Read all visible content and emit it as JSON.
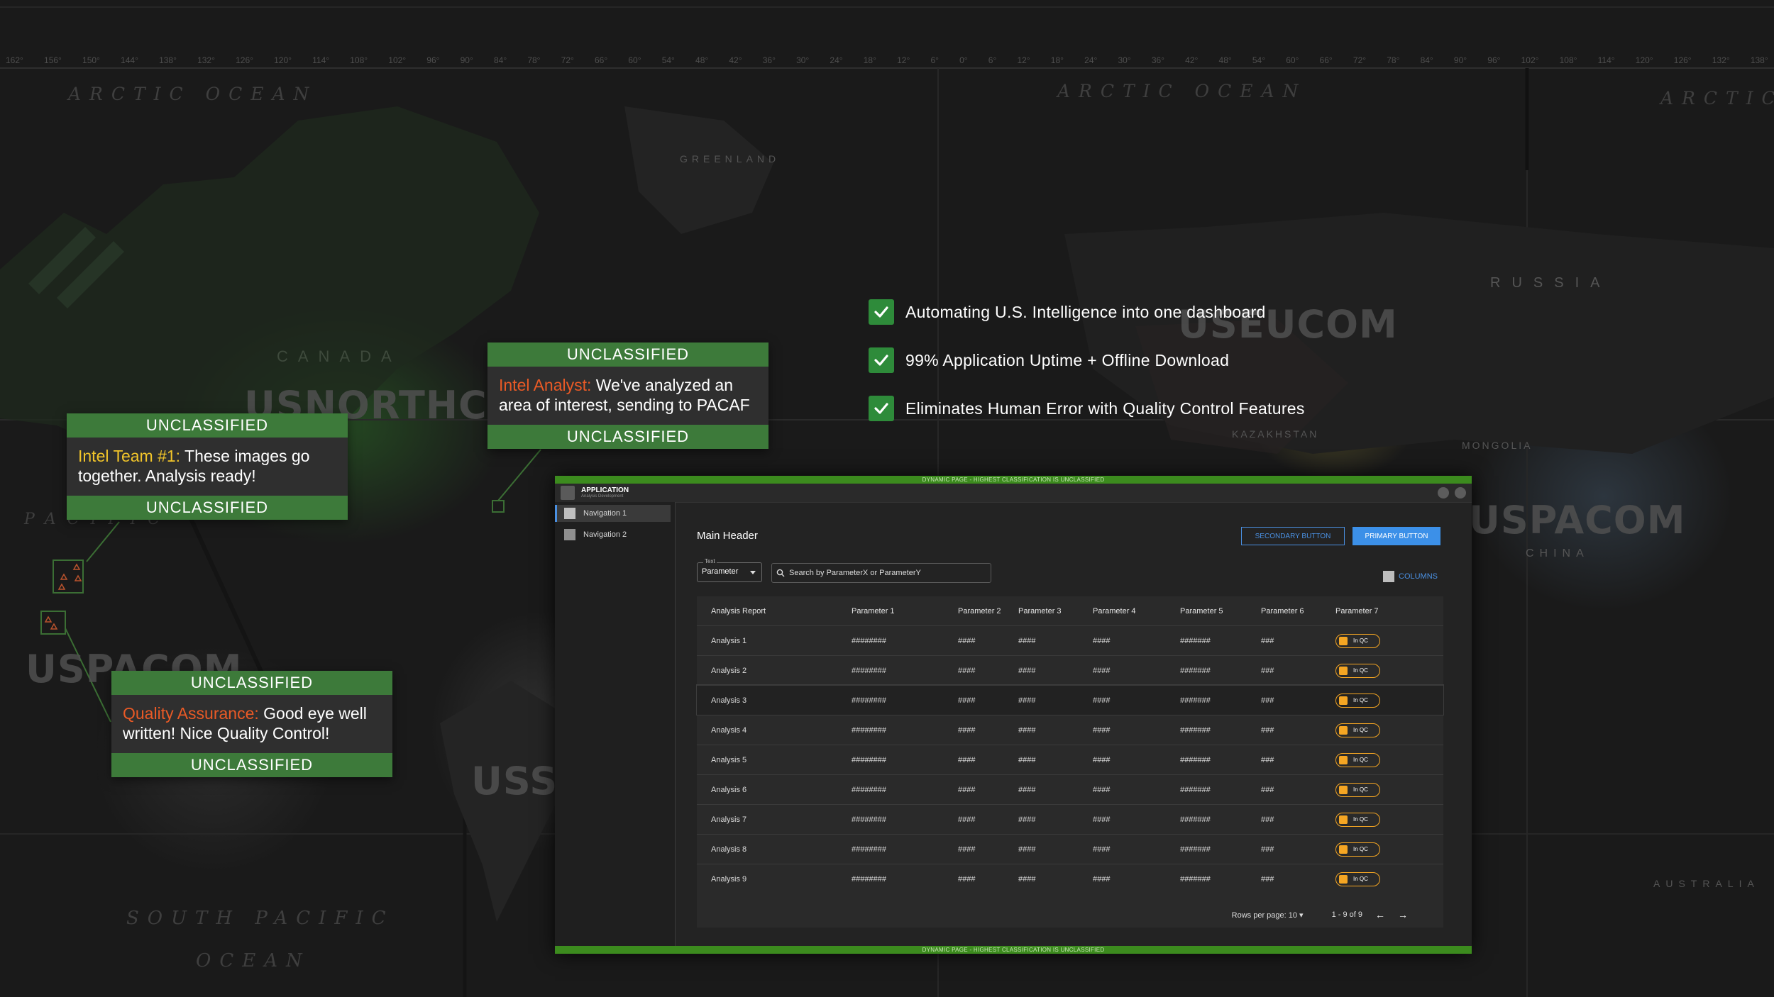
{
  "map": {
    "degree_labels": [
      "162°",
      "156°",
      "150°",
      "144°",
      "138°",
      "132°",
      "126°",
      "120°",
      "114°",
      "108°",
      "102°",
      "96°",
      "90°",
      "84°",
      "78°",
      "72°",
      "66°",
      "60°",
      "54°",
      "48°",
      "42°",
      "36°",
      "30°",
      "24°",
      "18°",
      "12°",
      "6°",
      "0°",
      "6°",
      "12°",
      "18°",
      "24°",
      "30°",
      "36°",
      "42°",
      "48°",
      "54°",
      "60°",
      "66°",
      "72°",
      "78°",
      "84°",
      "90°",
      "96°",
      "102°",
      "108°",
      "114°",
      "120°",
      "126°",
      "132°",
      "138°"
    ],
    "labels": {
      "arctic_ocean_1": "ARCTIC OCEAN",
      "arctic_ocean_2": "ARCTIC OCEAN",
      "arctic_ocean_3": "ARCTIC",
      "greenland": "GREENLAND",
      "canada": "CANADA",
      "russia": "RUSSIA",
      "china": "CHINA",
      "kazakhstan": "KAZAKHSTAN",
      "mongolia": "MONGOLIA",
      "south_pacific": "SOUTH PACIFIC",
      "ocean_bottom": "OCEAN",
      "pacific_left": "PACIFIC",
      "australia": "AUSTRALIA"
    },
    "commands": {
      "northcom": "USNORTHCOM",
      "eucom": "USEUCOM",
      "pacom": "USPACOM",
      "indopacom": "USPACOM",
      "southcom": "USS"
    }
  },
  "cards": [
    {
      "top_band": "UNCLASSIFIED",
      "speaker": "Intel Team #1:",
      "message": " These images go together. Analysis ready!",
      "bottom_band": "UNCLASSIFIED",
      "speaker_color": "#f2c52a"
    },
    {
      "top_band": "UNCLASSIFIED",
      "speaker": "Intel Analyst:",
      "message": " We've analyzed an area of interest, sending to PACAF",
      "bottom_band": "UNCLASSIFIED",
      "speaker_color": "#ea5a26"
    },
    {
      "top_band": "UNCLASSIFIED",
      "speaker": "Quality Assurance:",
      "message": " Good eye well written! Nice Quality Control!",
      "bottom_band": "UNCLASSIFIED",
      "speaker_color": "#ea5a26"
    }
  ],
  "features": [
    "Automating U.S. Intelligence into one dashboard",
    "99% Application Uptime + Offline Download",
    "Eliminates Human Error with Quality Control Features"
  ],
  "app": {
    "classification_banner": "DYNAMIC PAGE - HIGHEST CLASSIFICATION IS UNCLASSIFIED",
    "title": "APPLICATION",
    "subtitle": "Analysis Development",
    "nav": [
      "Navigation 1",
      "Navigation 2"
    ],
    "main_header": "Main Header",
    "secondary_button": "SECONDARY BUTTON",
    "primary_button": "PRIMARY BUTTON",
    "select_label": "Text",
    "select_value": "Parameter",
    "search_placeholder": "Search by ParameterX or ParameterY",
    "columns_label": "COLUMNS",
    "table": {
      "headers": [
        "Analysis Report",
        "Parameter 1",
        "Parameter 2",
        "Parameter 3",
        "Parameter 4",
        "Parameter 5",
        "Parameter 6",
        "Parameter 7"
      ],
      "rows": [
        [
          "Analysis 1",
          "########",
          "####",
          "####",
          "####",
          "#######",
          "###",
          "In QC"
        ],
        [
          "Analysis 2",
          "########",
          "####",
          "####",
          "####",
          "#######",
          "###",
          "In QC"
        ],
        [
          "Analysis 3",
          "########",
          "####",
          "####",
          "####",
          "#######",
          "###",
          "In QC"
        ],
        [
          "Analysis 4",
          "########",
          "####",
          "####",
          "####",
          "#######",
          "###",
          "In QC"
        ],
        [
          "Analysis 5",
          "########",
          "####",
          "####",
          "####",
          "#######",
          "###",
          "In QC"
        ],
        [
          "Analysis 6",
          "########",
          "####",
          "####",
          "####",
          "#######",
          "###",
          "In QC"
        ],
        [
          "Analysis 7",
          "########",
          "####",
          "####",
          "####",
          "#######",
          "###",
          "In QC"
        ],
        [
          "Analysis 8",
          "########",
          "####",
          "####",
          "####",
          "#######",
          "###",
          "In QC"
        ],
        [
          "Analysis 9",
          "########",
          "####",
          "####",
          "####",
          "#######",
          "###",
          "In QC"
        ]
      ]
    },
    "rows_per_page": "Rows per page: 10",
    "page_range": "1 - 9 of 9",
    "colors": {
      "accent": "#4a90e2",
      "status": "#f5a623",
      "classification": "#3c8b1e",
      "card_band": "#3d7a3a",
      "check": "#2e8b3a"
    }
  }
}
